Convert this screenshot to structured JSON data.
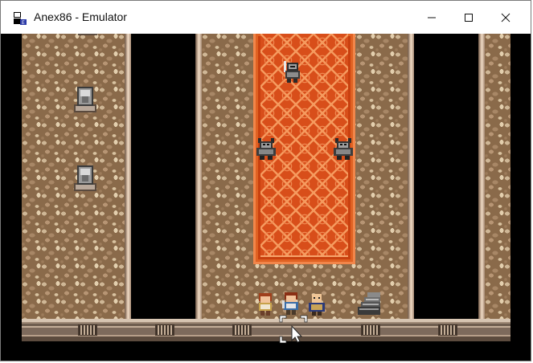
{
  "window": {
    "title": "Anex86 - Emulator",
    "controls": {
      "minimize": "minimize",
      "maximize": "maximize",
      "close": "close"
    }
  },
  "scene": {
    "floor_color": "#8a6a4a",
    "carpet_color": "#c8400f",
    "carpet_pattern_color": "#f59a5e",
    "void_color": "#000000",
    "statues": [
      "armor-stand",
      "armor-stand"
    ],
    "enemies": [
      "armored-knight",
      "gargoyle",
      "gargoyle"
    ],
    "party": [
      "hero-girl",
      "hero-boy",
      "bald-monk"
    ],
    "objects": [
      "staircase"
    ]
  }
}
